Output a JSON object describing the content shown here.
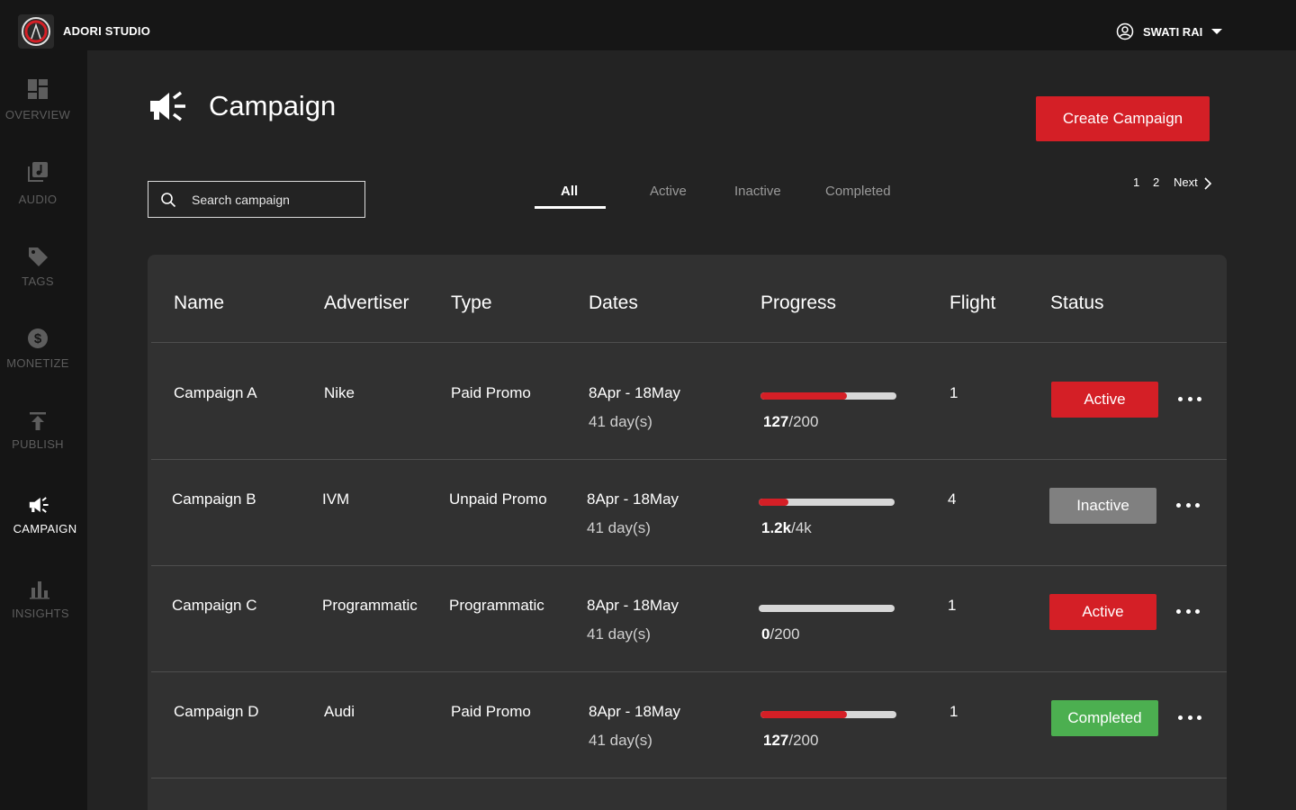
{
  "app": {
    "brand": "ADORI STUDIO"
  },
  "user": {
    "name": "SWATI RAI"
  },
  "sidebar": {
    "items": [
      {
        "label": "OVERVIEW",
        "icon": "dashboard-icon"
      },
      {
        "label": "AUDIO",
        "icon": "audio-library-icon"
      },
      {
        "label": "TAGS",
        "icon": "tag-icon"
      },
      {
        "label": "MONETIZE",
        "icon": "dollar-icon"
      },
      {
        "label": "PUBLISH",
        "icon": "publish-icon"
      },
      {
        "label": "CAMPAIGN",
        "icon": "megaphone-icon",
        "active": true
      },
      {
        "label": "INSIGHTS",
        "icon": "bar-chart-icon"
      }
    ]
  },
  "page": {
    "title": "Campaign",
    "create_label": "Create Campaign"
  },
  "search": {
    "placeholder": "Search campaign"
  },
  "tabs": [
    "All",
    "Active",
    "Inactive",
    "Completed"
  ],
  "pagination": {
    "pages": [
      "1",
      "2"
    ],
    "next_label": "Next"
  },
  "table": {
    "headers": [
      "Name",
      "Advertiser",
      "Type",
      "Dates",
      "Progress",
      "Flight",
      "Status"
    ],
    "rows": [
      {
        "name": "Campaign A",
        "advertiser": "Nike",
        "type": "Paid Promo",
        "dates": "8Apr - 18May",
        "duration": "41 day(s)",
        "progress_done": "127",
        "progress_total": "/200",
        "progress_fraction": 0.635,
        "flight": "1",
        "status": "Active",
        "status_color": "#d41f26"
      },
      {
        "name": "Campaign B",
        "advertiser": "IVM",
        "type": "Unpaid Promo",
        "dates": "8Apr - 18May",
        "duration": "41 day(s)",
        "progress_done": "1.2k",
        "progress_total": "/4k",
        "progress_fraction": 0.22,
        "flight": "4",
        "status": "Inactive",
        "status_color": "#808080"
      },
      {
        "name": "Campaign C",
        "advertiser": "Programmatic",
        "type": "Programmatic",
        "dates": "8Apr - 18May",
        "duration": "41 day(s)",
        "progress_done": "0",
        "progress_total": "/200",
        "progress_fraction": 0,
        "flight": "1",
        "status": "Active",
        "status_color": "#d41f26"
      },
      {
        "name": "Campaign D",
        "advertiser": "Audi",
        "type": "Paid Promo",
        "dates": "8Apr - 18May",
        "duration": "41 day(s)",
        "progress_done": "127",
        "progress_total": "/200",
        "progress_fraction": 0.635,
        "flight": "1",
        "status": "Completed",
        "status_color": "#4caf50"
      }
    ]
  }
}
